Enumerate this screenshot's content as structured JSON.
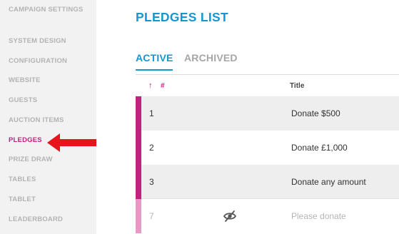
{
  "sidebar": {
    "items": [
      {
        "label": "CAMPAIGN SETTINGS",
        "active": false
      },
      {
        "label": "SYSTEM DESIGN",
        "active": false
      },
      {
        "label": "CONFIGURATION",
        "active": false
      },
      {
        "label": "WEBSITE",
        "active": false
      },
      {
        "label": "GUESTS",
        "active": false
      },
      {
        "label": "AUCTION ITEMS",
        "active": false
      },
      {
        "label": "PLEDGES",
        "active": true
      },
      {
        "label": "PRIZE DRAW",
        "active": false
      },
      {
        "label": "TABLES",
        "active": false
      },
      {
        "label": "TABLET",
        "active": false
      },
      {
        "label": "LEADERBOARD",
        "active": false
      }
    ]
  },
  "page": {
    "title": "PLEDGES LIST"
  },
  "tabs": [
    {
      "label": "ACTIVE",
      "active": true
    },
    {
      "label": "ARCHIVED",
      "active": false
    }
  ],
  "table": {
    "sort_icon": "↑",
    "columns": {
      "number": "#",
      "title": "Title"
    },
    "rows": [
      {
        "number": "1",
        "title": "Donate $500",
        "hidden": false
      },
      {
        "number": "2",
        "title": "Donate £1,000",
        "hidden": false
      },
      {
        "number": "3",
        "title": "Donate any amount",
        "hidden": false
      },
      {
        "number": "7",
        "title": "Please donate",
        "hidden": true,
        "icon": "eye-slash-icon"
      }
    ]
  },
  "colors": {
    "accent_blue": "#1596cf",
    "accent_magenta": "#c2217f",
    "arrow_red": "#e8141b",
    "sidebar_bg": "#f2f2f2"
  }
}
